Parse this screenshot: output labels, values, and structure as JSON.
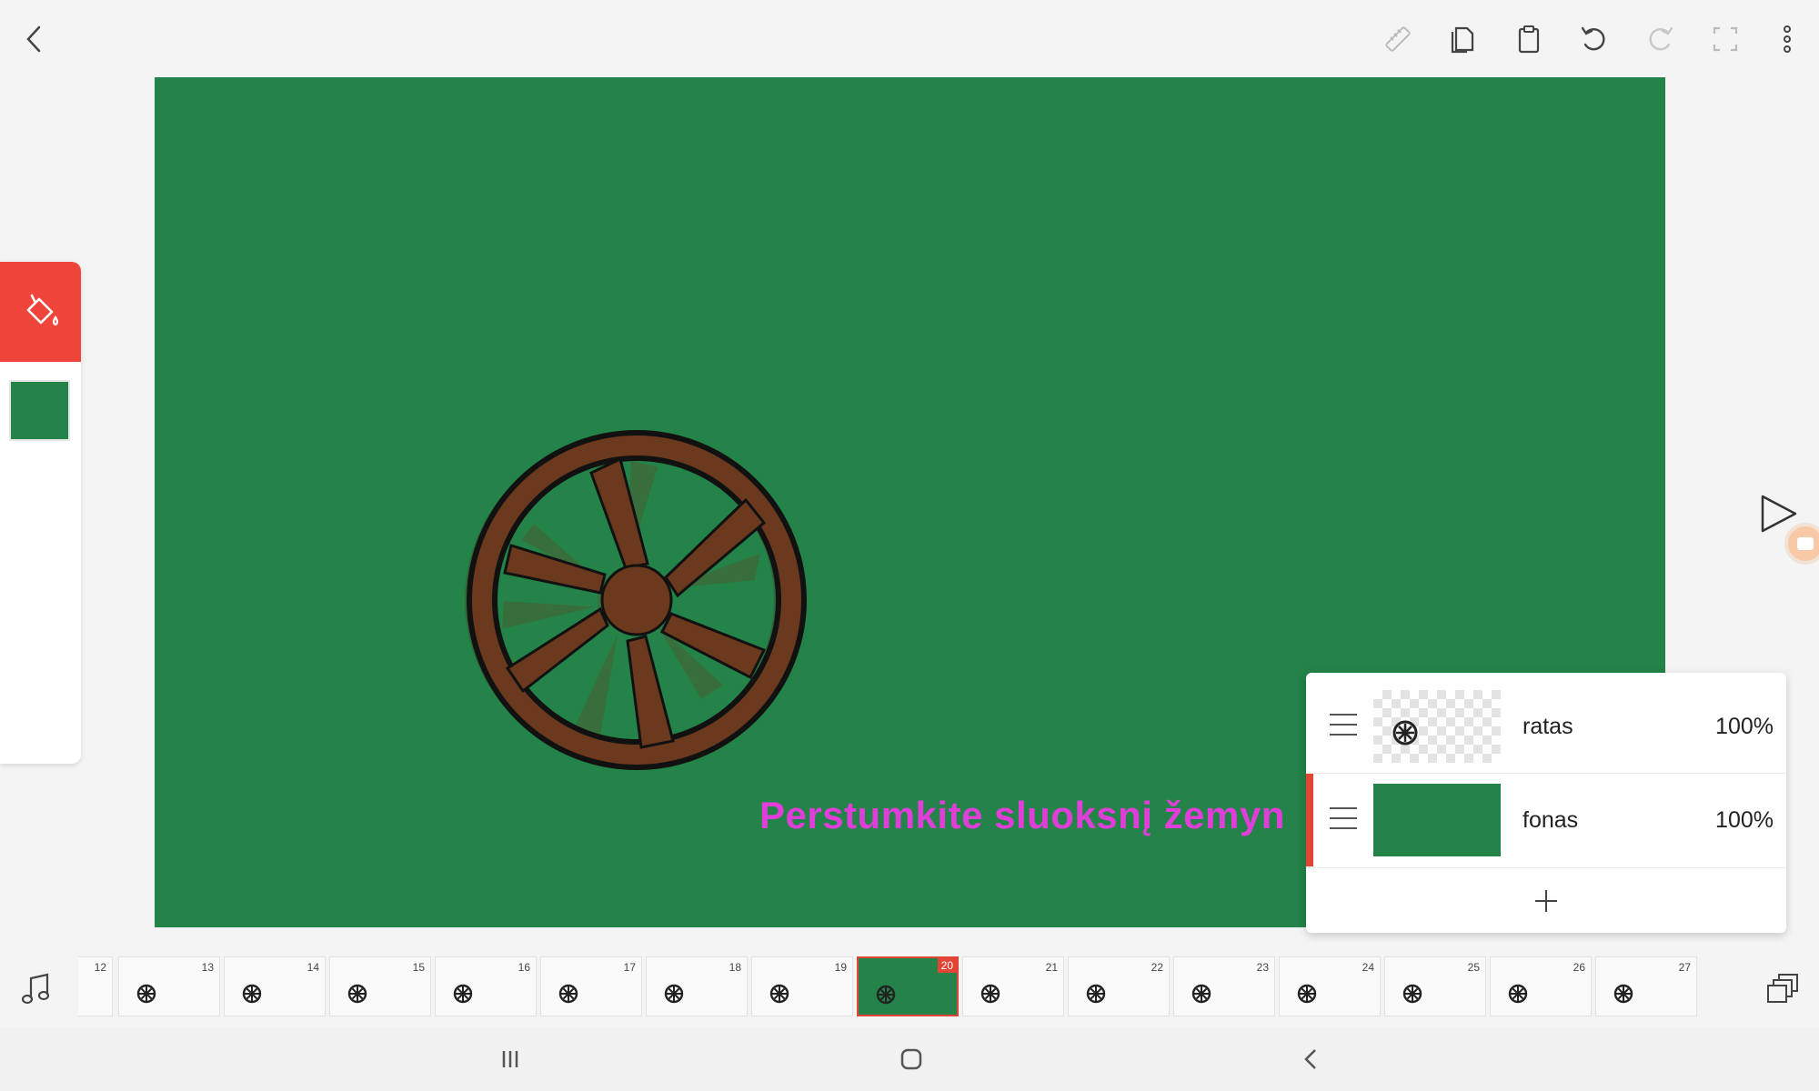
{
  "canvas": {
    "background_color": "#238348",
    "hint_text": "Perstumkite sluoksnį žemyn",
    "hint_color": "#df3fd8"
  },
  "toolbar": {
    "icons": [
      "back-icon",
      "ruler-icon",
      "copy-icon",
      "paste-icon",
      "undo-icon",
      "redo-icon",
      "fullscreen-icon",
      "more-icon"
    ]
  },
  "tool_panel": {
    "active_tool": "fill-bucket-icon",
    "accent": "#f0453a",
    "current_color": "#238348"
  },
  "layers": {
    "items": [
      {
        "name": "ratas",
        "opacity": "100%",
        "active": false
      },
      {
        "name": "fonas",
        "opacity": "100%",
        "active": true
      }
    ],
    "add_label": "+"
  },
  "timeline": {
    "frames": [
      "12",
      "13",
      "14",
      "15",
      "16",
      "17",
      "18",
      "19",
      "20",
      "21",
      "22",
      "23",
      "24",
      "25",
      "26",
      "27"
    ],
    "current_frame": "20",
    "layers_count": "1"
  }
}
